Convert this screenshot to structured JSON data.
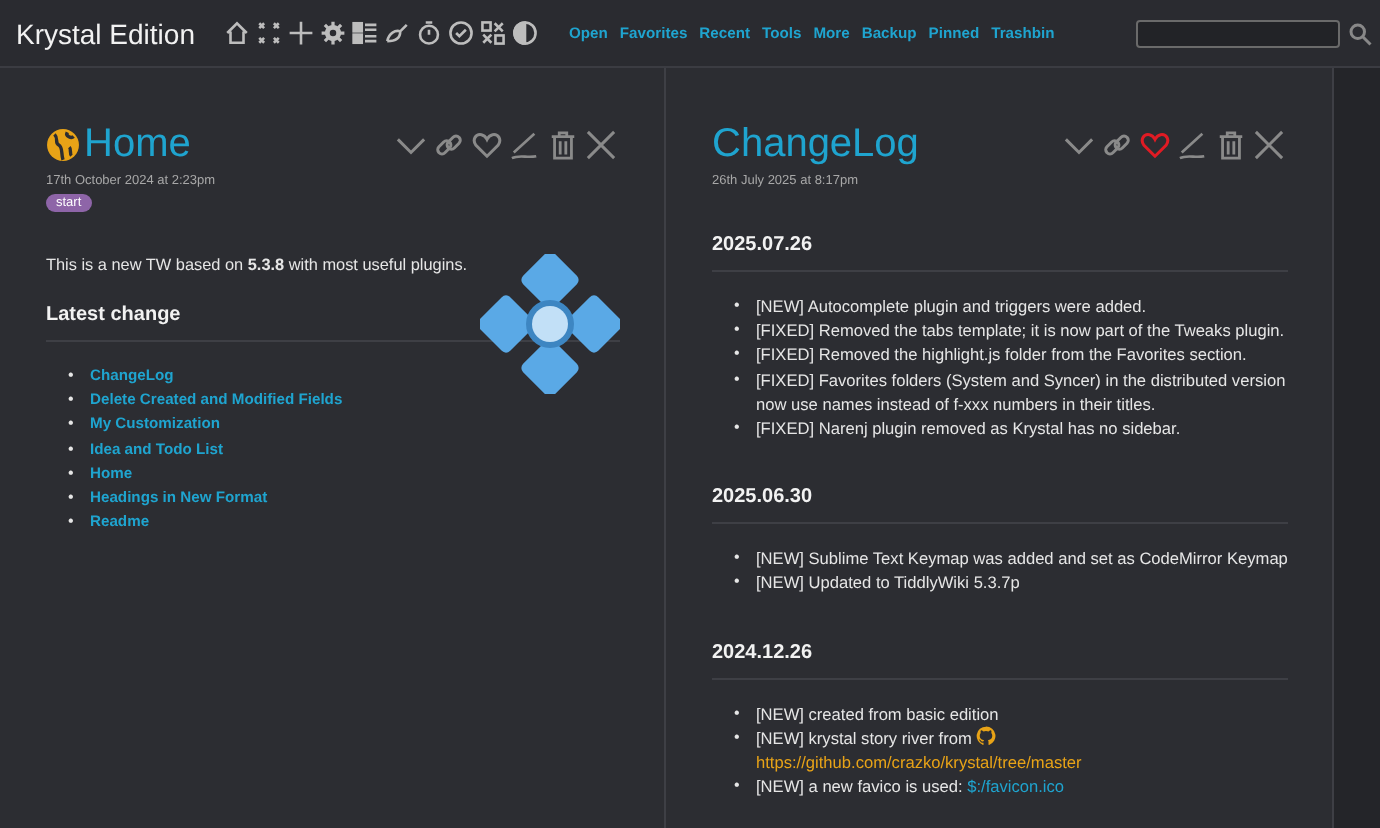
{
  "topbar": {
    "title": "Krystal Edition",
    "nav": [
      "Open",
      "Favorites",
      "Recent",
      "Tools",
      "More",
      "Backup",
      "Pinned",
      "Trashbin"
    ]
  },
  "tiddlers": [
    {
      "title": "Home",
      "has_globe": true,
      "date": "17th October 2024 at 2:23pm",
      "favorite": false,
      "tags": [
        "start"
      ],
      "blocks": [
        {
          "kind": "para",
          "text": "This is a new TW based on **5.3.8** with most useful plugins."
        },
        {
          "kind": "heading",
          "text": "Latest change"
        },
        {
          "kind": "links",
          "marker": "•",
          "items": [
            "ChangeLog",
            "Delete Created and Modified Fields",
            "My Customization",
            "Idea and Todo List",
            "Home",
            "Headings in New Format",
            "Readme"
          ]
        }
      ]
    },
    {
      "title": "ChangeLog",
      "has_globe": false,
      "date": "26th July 2025 at 8:17pm",
      "favorite": true,
      "blocks": [
        {
          "kind": "heading",
          "text": "2025.07.26"
        },
        {
          "kind": "bullets",
          "marker": "•",
          "items": [
            {
              "kind": "plain",
              "text": "[NEW] Autocomplete plugin and triggers were added."
            },
            {
              "kind": "plain",
              "text": "[FIXED] Removed the tabs template; it is now part of the Tweaks plugin."
            },
            {
              "kind": "plain",
              "text": "[FIXED] Removed the highlight.js folder from the Favorites section."
            },
            {
              "kind": "plain",
              "text": "[FIXED] Favorites folders (System and Syncer) in the distributed version now use names instead of f-xxx numbers in their titles."
            },
            {
              "kind": "plain",
              "text": "[FIXED] Narenj plugin removed as Krystal has no sidebar."
            }
          ]
        },
        {
          "kind": "heading",
          "text": "2025.06.30"
        },
        {
          "kind": "bullets",
          "marker": "•",
          "items": [
            {
              "kind": "plain",
              "text": "[NEW] Sublime Text Keymap was added and set as CodeMirror Keymap"
            },
            {
              "kind": "plain",
              "text": "[NEW] Updated to TiddlyWiki 5.3.7p"
            }
          ]
        },
        {
          "kind": "heading",
          "text": "2024.12.26"
        },
        {
          "kind": "bullets",
          "marker": "•",
          "items": [
            {
              "kind": "plain",
              "text": "[NEW] created from basic edition"
            },
            {
              "kind": "external",
              "text": "[NEW] krystal story river from",
              "link": "https://github.com/crazko/krystal/tree/master"
            },
            {
              "kind": "internal",
              "text": "[NEW] a new favico is used:",
              "link": "$:/favicon.ico"
            }
          ]
        }
      ]
    }
  ]
}
